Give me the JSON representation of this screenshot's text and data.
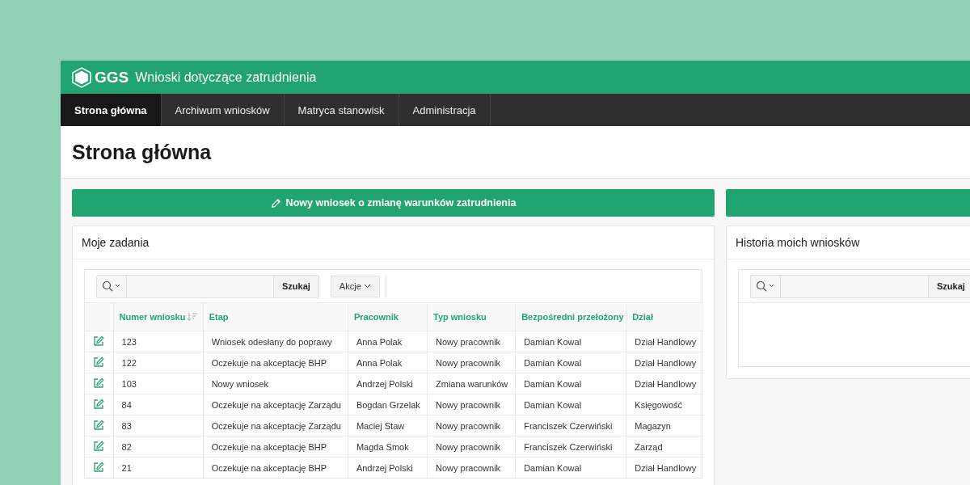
{
  "header": {
    "logo": "GGS",
    "title": "Wnioski dotyczące zatrudnienia"
  },
  "nav": [
    {
      "label": "Strona główna",
      "selected": true
    },
    {
      "label": "Archiwum wniosków",
      "selected": false
    },
    {
      "label": "Matryca stanowisk",
      "selected": false
    },
    {
      "label": "Administracja",
      "selected": false
    }
  ],
  "page_title": "Strona główna",
  "new_request_button": "Nowy wniosek o zmianę warunków zatrudnienia",
  "tasks": {
    "title": "Moje zadania",
    "search_button": "Szukaj",
    "actions_button": "Akcje",
    "columns": [
      {
        "label": "Numer wniosku",
        "sorted": true
      },
      {
        "label": "Etap",
        "sorted": false
      },
      {
        "label": "Pracownik",
        "sorted": false
      },
      {
        "label": "Typ wniosku",
        "sorted": false
      },
      {
        "label": "Bezpośredni przełożony",
        "sorted": false
      },
      {
        "label": "Dział",
        "sorted": false
      }
    ],
    "rows": [
      [
        "123",
        "Wniosek odesłany do poprawy",
        "Anna Polak",
        "Nowy pracownik",
        "Damian Kowal",
        "Dział Handlowy"
      ],
      [
        "122",
        "Oczekuje na akceptację BHP",
        "Anna Polak",
        "Nowy pracownik",
        "Damian Kowal",
        "Dział Handlowy"
      ],
      [
        "103",
        "Nowy wniosek",
        "Andrzej Polski",
        "Zmiana warunków",
        "Damian Kowal",
        "Dział Handlowy"
      ],
      [
        "84",
        "Oczekuje na akceptację Zarządu",
        "Bogdan Grzelak",
        "Nowy pracownik",
        "Damian Kowal",
        "Księgowość"
      ],
      [
        "83",
        "Oczekuje na akceptację Zarządu",
        "Maciej Staw",
        "Nowy pracownik",
        "Franciszek Czerwiński",
        "Magazyn"
      ],
      [
        "82",
        "Oczekuje na akceptację BHP",
        "Magda Smok",
        "Nowy pracownik",
        "Franciszek Czerwiński",
        "Zarząd"
      ],
      [
        "21",
        "Oczekuje na akceptację BHP",
        "Andrzej Polski",
        "Nowy pracownik",
        "Damian Kowal",
        "Dział Handlowy"
      ]
    ]
  },
  "history": {
    "title": "Historia moich wniosków",
    "search_button": "Szukaj"
  }
}
